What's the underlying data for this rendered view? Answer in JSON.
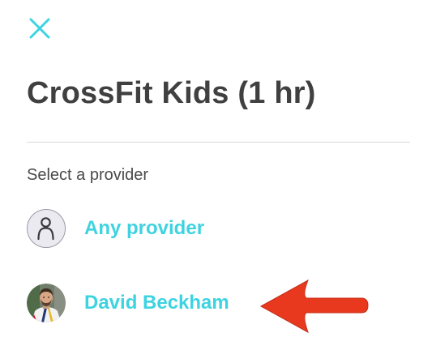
{
  "header": {
    "close_icon": "close-icon"
  },
  "title": "CrossFit Kids (1 hr)",
  "section_label": "Select a provider",
  "providers": [
    {
      "name": "Any provider",
      "avatar": "person-outline-icon"
    },
    {
      "name": "David Beckham",
      "avatar": "user-photo"
    }
  ],
  "annotation": {
    "arrow_icon": "red-arrow-icon",
    "arrow_color": "#e8391f"
  },
  "colors": {
    "accent": "#3dd3e0",
    "title": "#404040",
    "label": "#4a4a4a",
    "divider": "#d9d9d9"
  }
}
